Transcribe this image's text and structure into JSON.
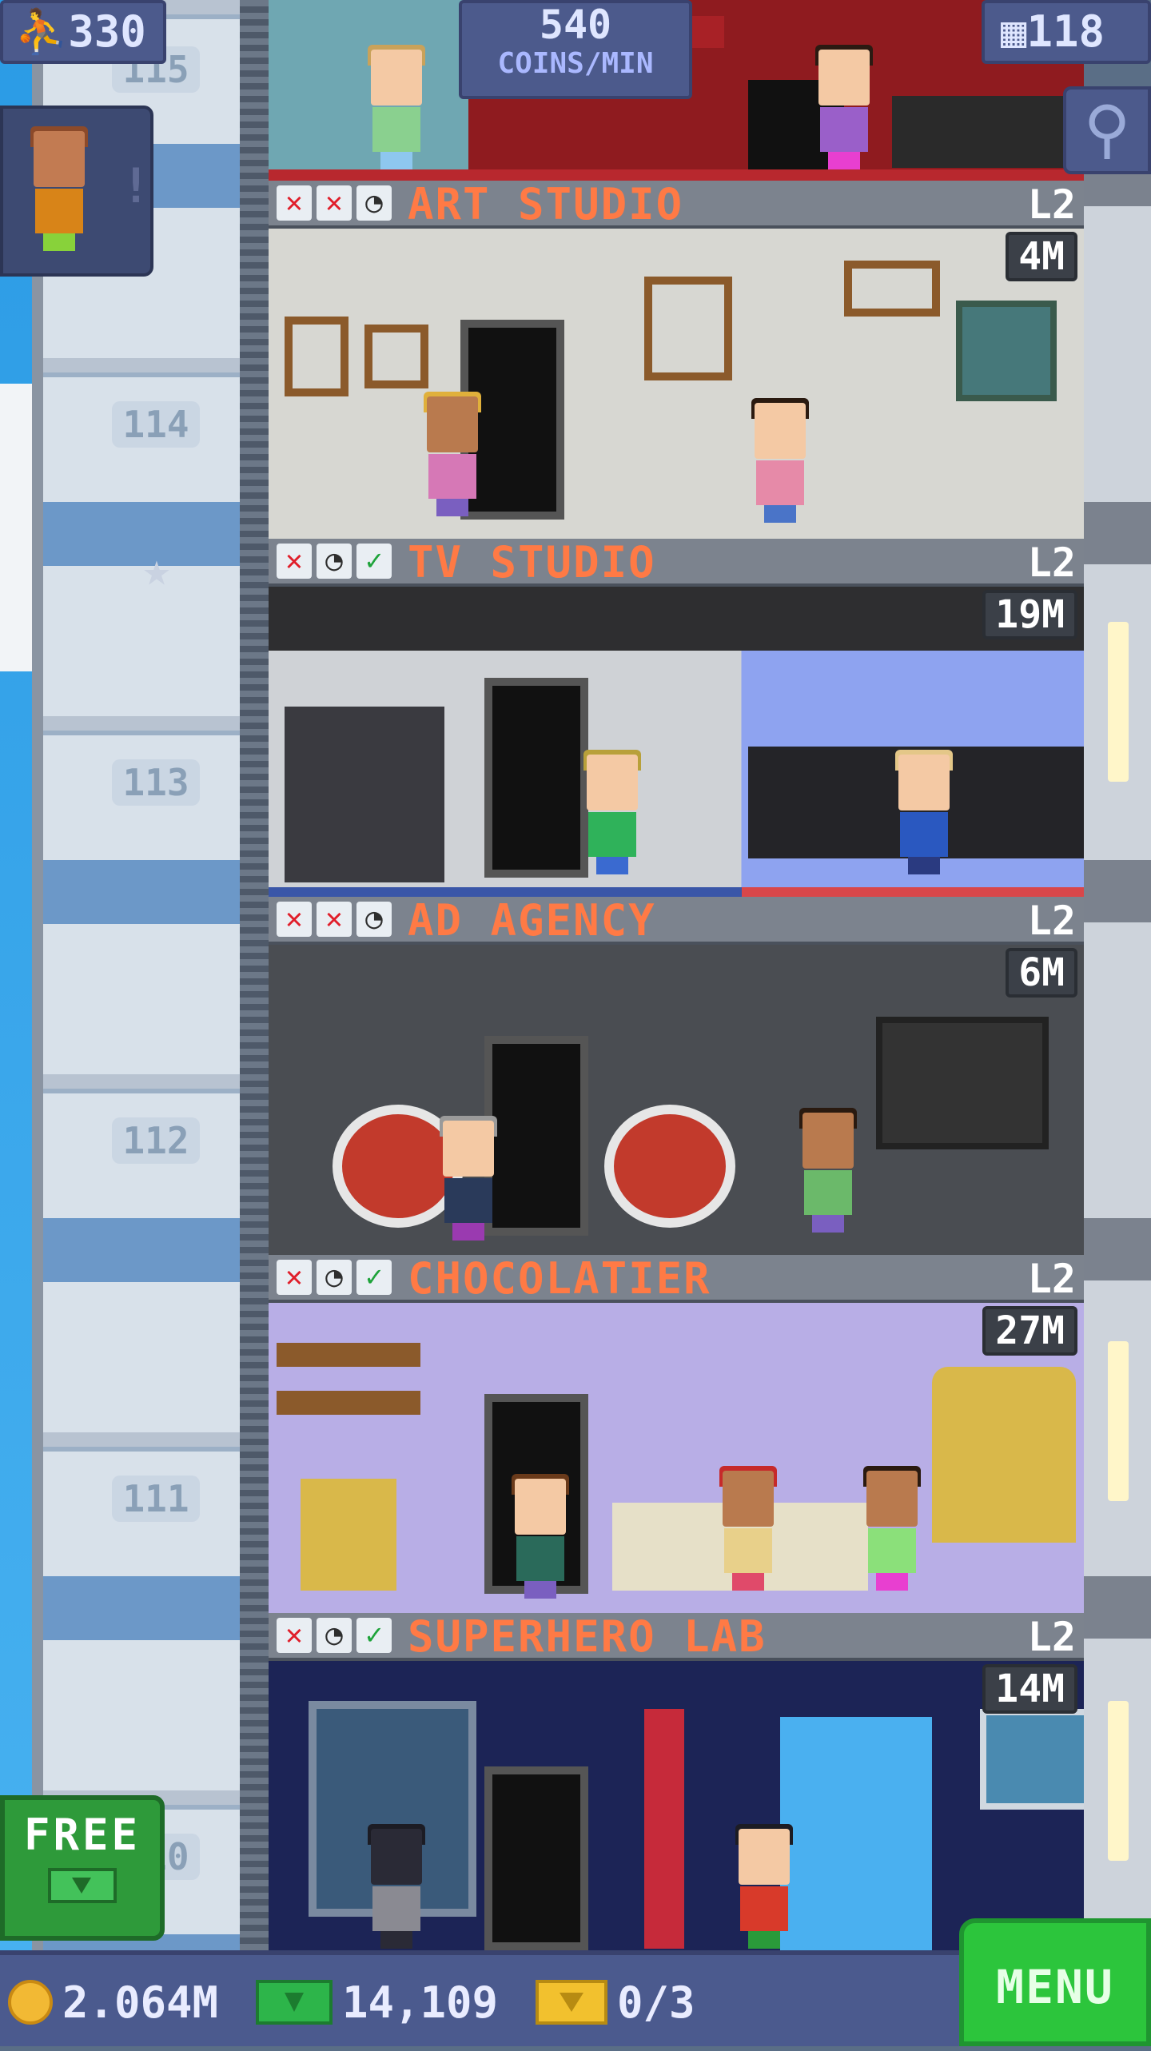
{
  "hud": {
    "population": "330",
    "coins_per_min_value": "540",
    "coins_per_min_unit": "COINS/MIN",
    "floors": "118"
  },
  "floor_numbers": [
    "115",
    "114",
    "113",
    "112",
    "111",
    "110"
  ],
  "floors": [
    {
      "name": "ART STUDIO",
      "level": "L2",
      "stock": "4M",
      "status": [
        "x",
        "x",
        "clock"
      ]
    },
    {
      "name": "TV STUDIO",
      "level": "L2",
      "stock": "19M",
      "status": [
        "x",
        "clock",
        "check"
      ]
    },
    {
      "name": "AD AGENCY",
      "level": "L2",
      "stock": "6M",
      "status": [
        "x",
        "x",
        "clock"
      ]
    },
    {
      "name": "CHOCOLATIER",
      "level": "L2",
      "stock": "27M",
      "status": [
        "x",
        "clock",
        "check"
      ]
    },
    {
      "name": "SUPERHERO LAB",
      "level": "L2",
      "stock": "14M",
      "status": [
        "x",
        "clock",
        "check"
      ]
    }
  ],
  "bottom_bar": {
    "coins": "2.064M",
    "bux": "14,109",
    "tickets": "0/3",
    "menu_label": "MENU"
  },
  "free_button_label": "FREE",
  "icons": {
    "population": "person-icon",
    "floors": "building-icon",
    "search": "magnifier-icon",
    "coin": "coin-icon",
    "bux": "bux-icon",
    "ticket": "ticket-icon",
    "star": "star-icon"
  },
  "colors": {
    "hud_bg": "#4c5a8c",
    "floor_name": "#ff7a45",
    "menu_green": "#2cc53c",
    "x_red": "#e01e2a",
    "check_green": "#1ea33a"
  }
}
